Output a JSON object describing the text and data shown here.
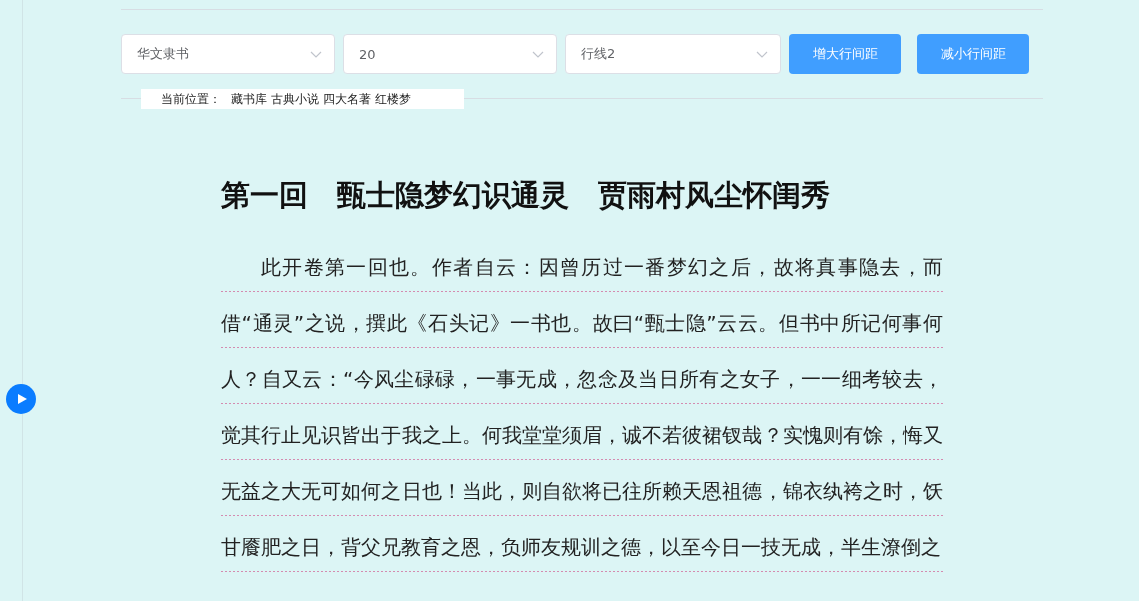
{
  "toolbar": {
    "selects": [
      {
        "value": "华文隶书"
      },
      {
        "value": "20"
      },
      {
        "value": "行线2"
      }
    ],
    "buttons": [
      "增大行间距",
      "减小行间距"
    ]
  },
  "breadcrumb": {
    "label": "当前位置：",
    "items": [
      "藏书库",
      "古典小说",
      "四大名著",
      "红楼梦"
    ]
  },
  "chapter": {
    "title": "第一回　甄士隐梦幻识通灵　贾雨村风尘怀闺秀",
    "text": "此开卷第一回也。作者自云：因曾历过一番梦幻之后，故将真事隐去，而借“通灵”之说，撰此《石头记》一书也。故曰“甄士隐”云云。但书中所记何事何人？自又云：“今风尘碌碌，一事无成，忽念及当日所有之女子，一一细考较去，觉其行止见识皆出于我之上。何我堂堂须眉，诚不若彼裙钗哉？实愧则有馀，悔又无益之大无可如何之日也！当此，则自欲将已往所赖天恩祖德，锦衣纨袴之时，饫甘餍肥之日，背父兄教育之恩，负师友规训之德，以至今日一技无成，半生潦倒之"
  }
}
